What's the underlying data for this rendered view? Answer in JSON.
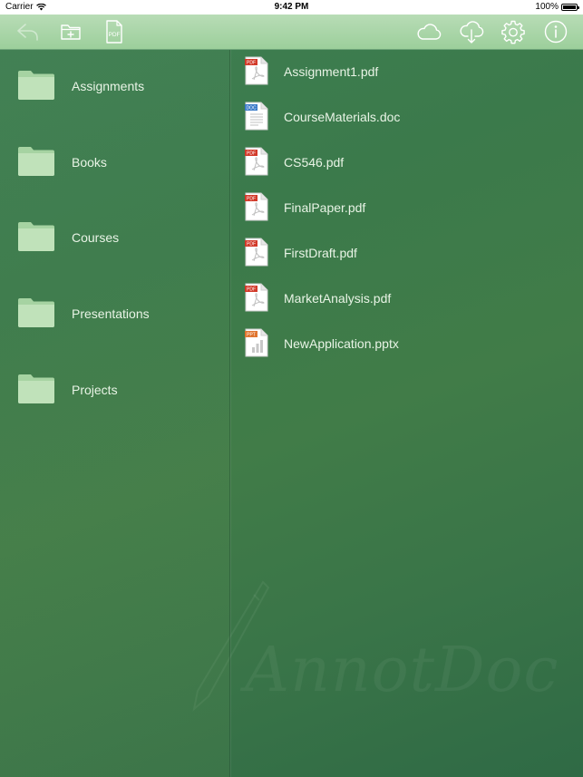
{
  "status_bar": {
    "carrier": "Carrier",
    "time": "9:42 PM",
    "battery": "100%"
  },
  "toolbar": {
    "back_icon": "back-arrow-icon",
    "new_folder_icon": "new-folder-icon",
    "pdf_icon": "pdf-document-icon",
    "pdf_label": "PDF",
    "cloud_icon": "cloud-icon",
    "cloud_download_icon": "cloud-download-icon",
    "settings_icon": "gear-icon",
    "info_icon": "info-icon"
  },
  "folders": [
    {
      "label": "Assignments"
    },
    {
      "label": "Books"
    },
    {
      "label": "Courses"
    },
    {
      "label": "Presentations"
    },
    {
      "label": "Projects"
    }
  ],
  "files": [
    {
      "name": "Assignment1.pdf",
      "type": "PDF"
    },
    {
      "name": "CourseMaterials.doc",
      "type": "DOC"
    },
    {
      "name": "CS546.pdf",
      "type": "PDF"
    },
    {
      "name": "FinalPaper.pdf",
      "type": "PDF"
    },
    {
      "name": "FirstDraft.pdf",
      "type": "PDF"
    },
    {
      "name": "MarketAnalysis.pdf",
      "type": "PDF"
    },
    {
      "name": "NewApplication.pptx",
      "type": "PPT"
    }
  ],
  "watermark": "AnnotDoc",
  "colors": {
    "background": "#3b7a4b",
    "toolbar": "#a9d6a8",
    "folder": "#b9dfb3",
    "pdf_badge": "#d23a2a",
    "doc_badge": "#3b7bc8",
    "ppt_badge": "#e0752f"
  }
}
